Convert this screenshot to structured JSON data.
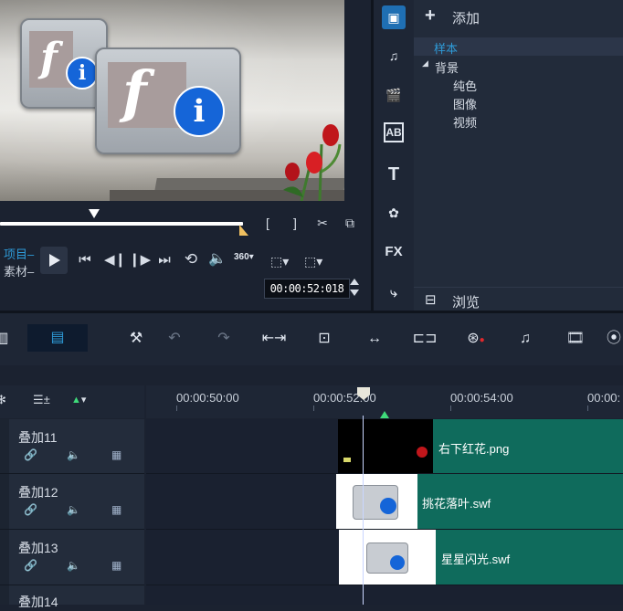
{
  "player": {
    "mode_project": "项目",
    "mode_clip": "素材",
    "timecode": "00:00:52:018",
    "mark_in": "[",
    "mark_out": "]",
    "badge_360": "360"
  },
  "library": {
    "add_label": "添加",
    "tree": [
      {
        "label": "样本",
        "level": 0,
        "selected": true
      },
      {
        "label": "背景",
        "level": 0,
        "expanded": true
      },
      {
        "label": "纯色",
        "level": 1
      },
      {
        "label": "图像",
        "level": 1
      },
      {
        "label": "视频",
        "level": 1
      }
    ],
    "browse_label": "浏览"
  },
  "side_icons": [
    "media-icon",
    "audio-icon",
    "instant-project-icon",
    "title-icon",
    "text-icon",
    "graphics-icon",
    "fx-icon",
    "path-icon"
  ],
  "side_labels": {
    "title": "AB",
    "text": "T",
    "fx": "FX"
  },
  "ruler": {
    "labels": [
      "00:00:50:00",
      "00:00:52:00",
      "00:00:54:00",
      "00:00:"
    ]
  },
  "tracks": [
    {
      "name": "叠加11",
      "clip": "右下红花.png"
    },
    {
      "name": "叠加12",
      "clip": "挑花落叶.swf"
    },
    {
      "name": "叠加13",
      "clip": "星星闪光.swf"
    },
    {
      "name": "叠加14",
      "clip": ""
    }
  ],
  "colors": {
    "accent": "#2e9bd8",
    "clip": "#0f6b5c",
    "marker": "#3fdb7a",
    "scrub_end": "#f0c060"
  }
}
